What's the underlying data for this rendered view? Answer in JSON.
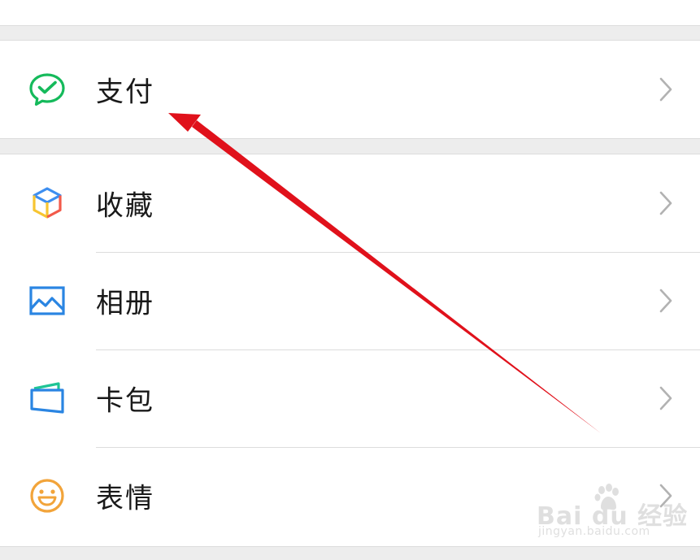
{
  "menu": {
    "pay": {
      "label": "支付",
      "icon": "wechat-pay-icon"
    },
    "items": [
      {
        "label": "收藏",
        "icon": "favorites-cube-icon"
      },
      {
        "label": "相册",
        "icon": "album-picture-icon"
      },
      {
        "label": "卡包",
        "icon": "card-wallet-icon"
      },
      {
        "label": "表情",
        "icon": "smiley-face-icon"
      }
    ]
  },
  "watermark": {
    "brand": "Bai du 经验",
    "url": "jingyan.baidu.com"
  },
  "colors": {
    "pay_green": "#15ba5b",
    "favorites_blue": "#3d8ef0",
    "favorites_red": "#f25a4a",
    "favorites_yellow": "#f7c531",
    "album_blue": "#2a85e2",
    "card_blue": "#2a85e2",
    "card_green": "#1ec495",
    "smiley_orange": "#f2a43a",
    "annotation_arrow": "#e0111b"
  }
}
